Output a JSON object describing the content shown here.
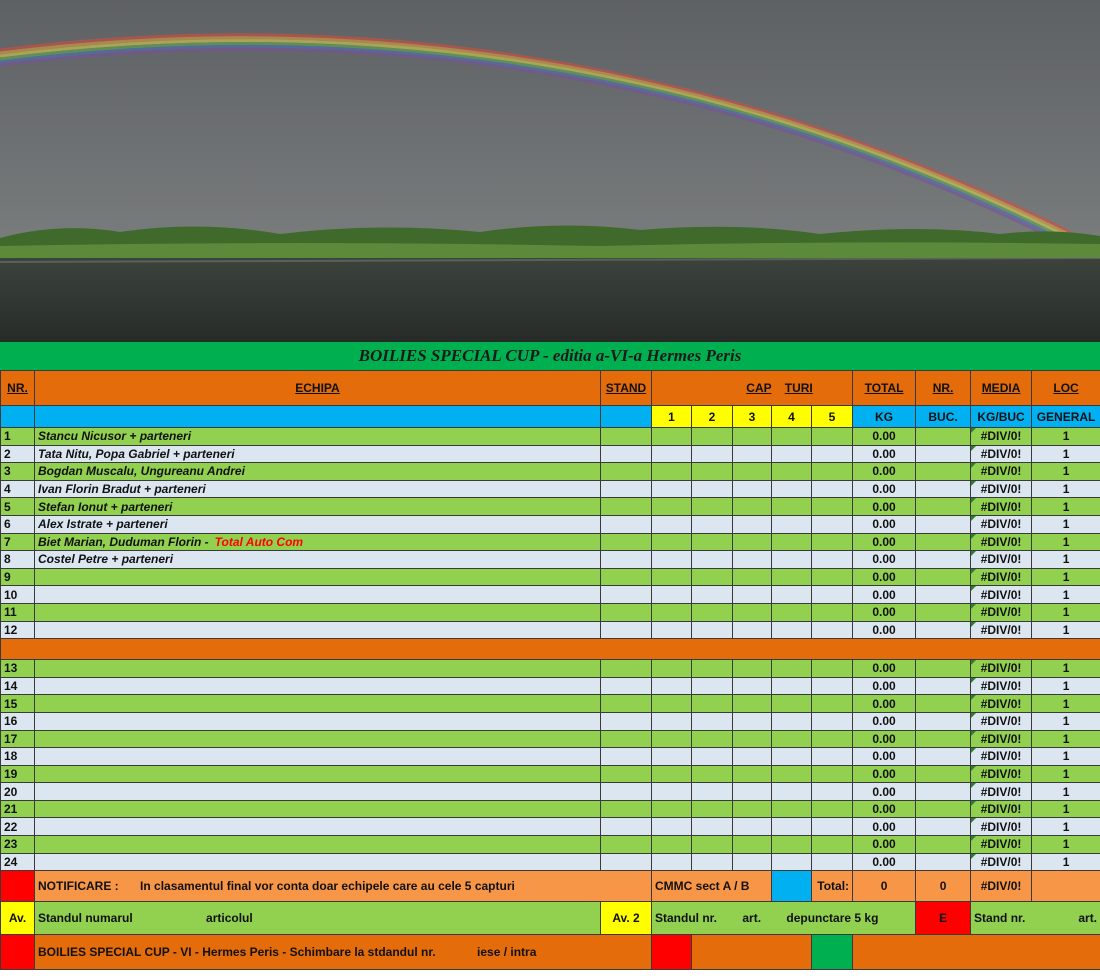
{
  "colors": {
    "header_orange": "#e46c0a",
    "subheader_blue": "#00b0f0",
    "row_green": "#92d050",
    "row_blue": "#dce6f1",
    "title_green": "#00b050"
  },
  "title": "BOILIES SPECIAL CUP - editia a-VI-a Hermes Peris",
  "header": {
    "nr": "NR.",
    "echipa": "ECHIPA",
    "stand": "STAND",
    "cap": "CAP",
    "turi": "TURI",
    "total": "TOTAL",
    "nr2": "NR.",
    "media": "MEDIA",
    "loc": "LOC",
    "rounds": [
      "1",
      "2",
      "3",
      "4",
      "5"
    ],
    "kg": "KG",
    "buc": "BUC.",
    "kgbuc": "KG/BUC",
    "general": "GENERAL"
  },
  "rows_a": [
    {
      "nr": "1",
      "team": "Stancu  Nicusor + parteneri",
      "sponsor": "",
      "total": "0.00",
      "media": "#DIV/0!",
      "loc": "1"
    },
    {
      "nr": "2",
      "team": "Tata Nitu, Popa Gabriel + parteneri",
      "sponsor": "",
      "total": "0.00",
      "media": "#DIV/0!",
      "loc": "1"
    },
    {
      "nr": "3",
      "team": "Bogdan Muscalu, Ungureanu Andrei",
      "sponsor": "",
      "total": "0.00",
      "media": "#DIV/0!",
      "loc": "1"
    },
    {
      "nr": "4",
      "team": "Ivan  Florin Bradut + parteneri",
      "sponsor": "",
      "total": "0.00",
      "media": "#DIV/0!",
      "loc": "1"
    },
    {
      "nr": "5",
      "team": "Stefan Ionut + parteneri",
      "sponsor": "",
      "total": "0.00",
      "media": "#DIV/0!",
      "loc": "1"
    },
    {
      "nr": "6",
      "team": "Alex  Istrate + parteneri",
      "sponsor": "",
      "total": "0.00",
      "media": "#DIV/0!",
      "loc": "1"
    },
    {
      "nr": "7",
      "team": "Biet Marian, Duduman Florin -",
      "sponsor": "Total Auto Com",
      "total": "0.00",
      "media": "#DIV/0!",
      "loc": "1"
    },
    {
      "nr": "8",
      "team": "Costel  Petre + parteneri",
      "sponsor": "",
      "total": "0.00",
      "media": "#DIV/0!",
      "loc": "1"
    },
    {
      "nr": "9",
      "team": "",
      "sponsor": "",
      "total": "0.00",
      "media": "#DIV/0!",
      "loc": "1"
    },
    {
      "nr": "10",
      "team": "",
      "sponsor": "",
      "total": "0.00",
      "media": "#DIV/0!",
      "loc": "1"
    },
    {
      "nr": "11",
      "team": "",
      "sponsor": "",
      "total": "0.00",
      "media": "#DIV/0!",
      "loc": "1"
    },
    {
      "nr": "12",
      "team": "",
      "sponsor": "",
      "total": "0.00",
      "media": "#DIV/0!",
      "loc": "1"
    }
  ],
  "rows_b": [
    {
      "nr": "13",
      "team": "",
      "sponsor": "",
      "total": "0.00",
      "media": "#DIV/0!",
      "loc": "1"
    },
    {
      "nr": "14",
      "team": "",
      "sponsor": "",
      "total": "0.00",
      "media": "#DIV/0!",
      "loc": "1"
    },
    {
      "nr": "15",
      "team": "",
      "sponsor": "",
      "total": "0.00",
      "media": "#DIV/0!",
      "loc": "1"
    },
    {
      "nr": "16",
      "team": "",
      "sponsor": "",
      "total": "0.00",
      "media": "#DIV/0!",
      "loc": "1"
    },
    {
      "nr": "17",
      "team": "",
      "sponsor": "",
      "total": "0.00",
      "media": "#DIV/0!",
      "loc": "1"
    },
    {
      "nr": "18",
      "team": "",
      "sponsor": "",
      "total": "0.00",
      "media": "#DIV/0!",
      "loc": "1"
    },
    {
      "nr": "19",
      "team": "",
      "sponsor": "",
      "total": "0.00",
      "media": "#DIV/0!",
      "loc": "1"
    },
    {
      "nr": "20",
      "team": "",
      "sponsor": "",
      "total": "0.00",
      "media": "#DIV/0!",
      "loc": "1"
    },
    {
      "nr": "21",
      "team": "",
      "sponsor": "",
      "total": "0.00",
      "media": "#DIV/0!",
      "loc": "1"
    },
    {
      "nr": "22",
      "team": "",
      "sponsor": "",
      "total": "0.00",
      "media": "#DIV/0!",
      "loc": "1"
    },
    {
      "nr": "23",
      "team": "",
      "sponsor": "",
      "total": "0.00",
      "media": "#DIV/0!",
      "loc": "1"
    },
    {
      "nr": "24",
      "team": "",
      "sponsor": "",
      "total": "0.00",
      "media": "#DIV/0!",
      "loc": "1"
    }
  ],
  "footer": {
    "notificare_label": "NOTIFICARE :",
    "notificare_text": "In clasamentul final vor conta doar echipele care au cele 5 capturi",
    "cmmc": "CMMC sect  A / B",
    "total_label": "Total:",
    "total_kg": "0",
    "total_buc": "0",
    "total_media": "#DIV/0!",
    "av1": "Av.",
    "standul": "Standul numarul",
    "articolul": "articolul",
    "av2": "Av. 2",
    "standul_nr": "Standul  nr.",
    "art": "art.",
    "depunctare": "depunctare 5 kg",
    "e": "E",
    "stand_nr": "Stand nr.",
    "art2": "art.",
    "bottom_text": "BOILIES SPECIAL CUP - VI - Hermes Peris - Schimbare la stdandul  nr.",
    "iese": "iese / intra"
  }
}
